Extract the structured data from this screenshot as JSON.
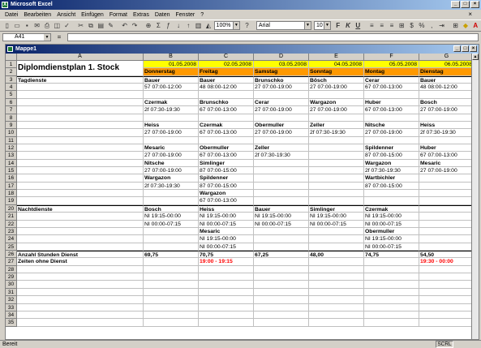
{
  "app": {
    "title": "Microsoft Excel",
    "workbook": "Mappe1"
  },
  "menu": [
    "Datei",
    "Bearbeiten",
    "Ansicht",
    "Einfügen",
    "Format",
    "Extras",
    "Daten",
    "Fenster",
    "?"
  ],
  "toolbar": {
    "zoom": "100%",
    "font": "Arial",
    "size": "10"
  },
  "formula": {
    "cell_ref": "A41",
    "eq": "="
  },
  "columns": [
    "A",
    "B",
    "C",
    "D",
    "E",
    "F",
    "G"
  ],
  "colors": {
    "date_bg": "#ffff00",
    "day_bg": "#ff9900",
    "red_text": "#ff0000",
    "title_bar": "#0a246a"
  },
  "sheet": {
    "title": "Diplomdienstplan 1. Stock",
    "dates": [
      "01.05.2008",
      "02.05.2008",
      "03.05.2008",
      "04.05.2008",
      "05.05.2008",
      "06.05.2008"
    ],
    "days": [
      "Donnerstag",
      "Freitag",
      "Samstag",
      "Sonntag",
      "Montag",
      "Dienstag"
    ],
    "row_labels": {
      "tagdienste": "Tagdienste",
      "nachtdienste": "Nachtdienste",
      "stunden": "Anzahl Stunden Dienst",
      "zeiten": "Zeiten ohne Dienst"
    },
    "cells": {
      "B3": "Bauer",
      "C3": "Bauer",
      "D3": "Brunschko",
      "E3": "Bösch",
      "F3": "Cerar",
      "G3": "Bauer",
      "B4": "57 07:00-12:00",
      "C4": "48 08:00-12:00",
      "D4": "27 07:00-19:00",
      "E4": "27 07:00-19:00",
      "F4": "67 07:00-13:00",
      "G4": "48 08:00-12:00",
      "B6": "Czermak",
      "C6": "Brunschko",
      "D6": "Cerar",
      "E6": "Wargazon",
      "F6": "Huber",
      "G6": "Bosch",
      "B7": "2f 07:30-19:30",
      "C7": "67 07:00-13:00",
      "D7": "27 07:00-19:00",
      "E7": "27 07:00-19:00",
      "F7": "67 07:00-13:00",
      "G7": "27 07:00-19:00",
      "B9": "Heiss",
      "C9": "Czermak",
      "D9": "Obermuller",
      "E9": "Zeller",
      "F9": "Nitsche",
      "G9": "Heiss",
      "B10": "27 07:00-19:00",
      "C10": "67 07:00-13:00",
      "D10": "27 07:00-19:00",
      "E10": "2f 07:30-19:30",
      "F10": "27 07:00-19:00",
      "G10": "2f 07:30-19:30",
      "B12": "Mesaric",
      "C12": "Obermuller",
      "D12": "Zeller",
      "F12": "Spildenner",
      "G12": "Huber",
      "B13": "27 07:00-19:00",
      "C13": "67 07:00-13:00",
      "D13": "2f 07:30-19:30",
      "F13": "87 07:00-15:00",
      "G13": "67 07:00-13:00",
      "B14": "Nitsche",
      "C14": "Simlinger",
      "F14": "Wargazon",
      "G14": "Mesaric",
      "B15": "27 07:00-19:00",
      "C15": "87 07:00-15:00",
      "F15": "2f 07:30-19:30",
      "G15": "27 07:00-19:00",
      "B16": "Wargazon",
      "C16": "Spildenner",
      "F16": "Wartbichler",
      "B17": "2f 07:30-19:30",
      "C17": "87 07:00-15:00",
      "F17": "87 07:00-15:00",
      "C18": "Wargazon",
      "C19": "67 07:00-13:00",
      "B20": "Bosch",
      "C20": "Heiss",
      "D20": "Bauer",
      "E20": "Simlinger",
      "F20": "Czermak",
      "B21": "NI 19:15-00:00",
      "C21": "NI 19:15-00:00",
      "D21": "NI 19:15-00:00",
      "E21": "NI 19:15-00:00",
      "F21": "NI 19:15-00:00",
      "B22": "NI 00:00-07:15",
      "C22": "NI 00:00-07:15",
      "D22": "NI 00:00-07:15",
      "E22": "NI 00:00-07:15",
      "F22": "NI 00:00-07:15",
      "C23": "Mesaric",
      "F23": "Obermuller",
      "C24": "NI 19:15-00:00",
      "F24": "NI 19:15-00:00",
      "C25": "NI 00:00-07:15",
      "F25": "NI 00:00-07:15",
      "B26": "69,75",
      "C26": "70,75",
      "D26": "67,25",
      "E26": "48,00",
      "F26": "74,75",
      "G26": "54,50",
      "C27": "19:00 - 19:15",
      "G27": "19:30 - 00:00"
    }
  },
  "status": {
    "left": "Bereit",
    "right": "SCRL"
  }
}
